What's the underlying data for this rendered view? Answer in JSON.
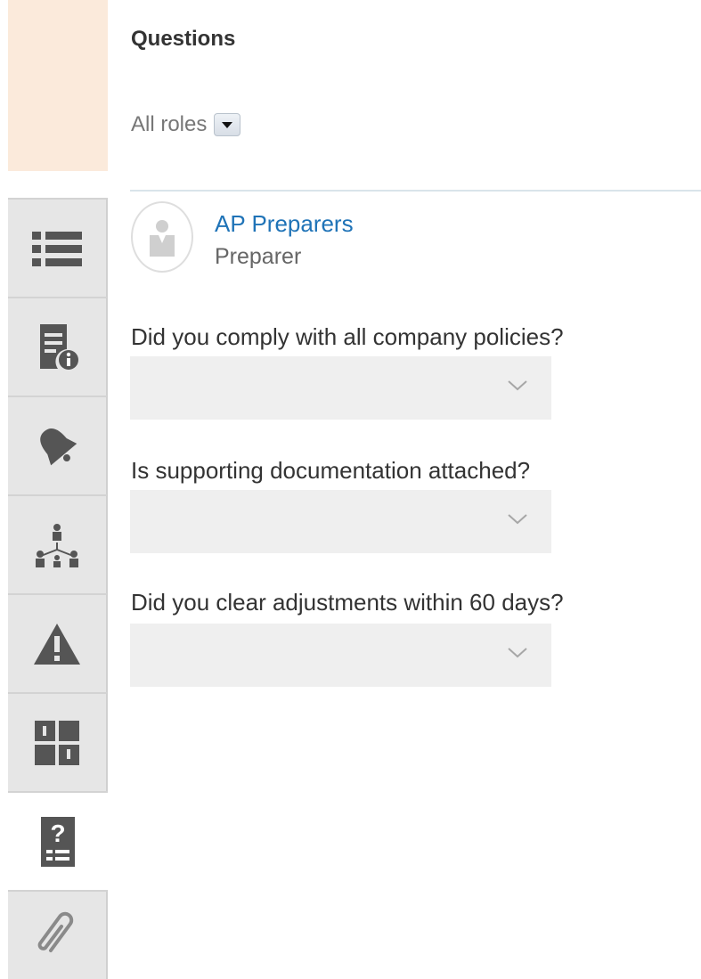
{
  "panel": {
    "title": "Questions",
    "role_filter": {
      "label": "All roles"
    }
  },
  "assignee": {
    "name": "AP Preparers",
    "role": "Preparer"
  },
  "questions": [
    {
      "label": "Did you comply with all company policies?",
      "value": ""
    },
    {
      "label": "Is supporting documentation attached?",
      "value": ""
    },
    {
      "label": "Did you clear adjustments within 60 days?",
      "value": ""
    }
  ],
  "rail": {
    "tabs": [
      {
        "icon": "list-icon",
        "active": false
      },
      {
        "icon": "document-info-icon",
        "active": false
      },
      {
        "icon": "bell-icon",
        "active": false
      },
      {
        "icon": "hierarchy-icon",
        "active": false
      },
      {
        "icon": "warning-icon",
        "active": false
      },
      {
        "icon": "workflow-icon",
        "active": false
      },
      {
        "icon": "question-document-icon",
        "active": true
      },
      {
        "icon": "paperclip-icon",
        "active": false
      }
    ]
  },
  "colors": {
    "accent_link": "#1f73b7",
    "rail_highlight": "#fbeadb",
    "icon": "#555555"
  }
}
